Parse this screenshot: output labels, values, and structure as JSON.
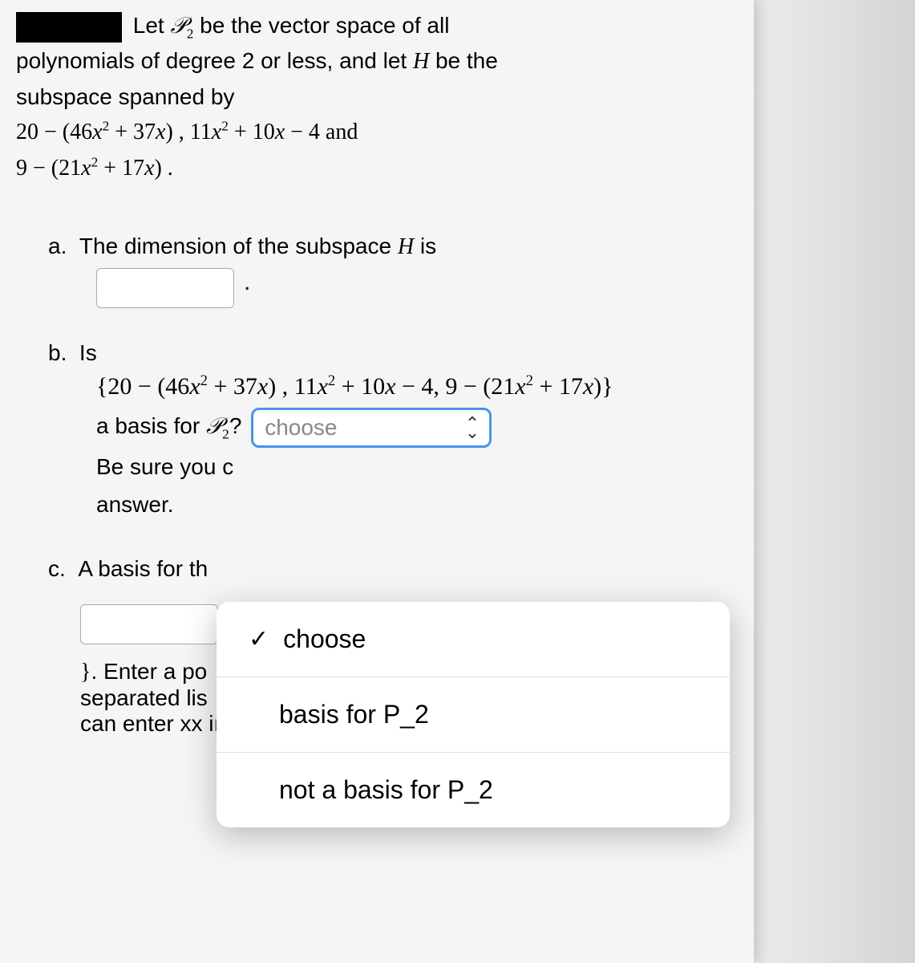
{
  "intro": {
    "line1": " Let ",
    "p2_html": "𝒫",
    "line1b": " be the vector space of all",
    "line2": "polynomials of degree 2 or less, and let ",
    "H": "H",
    "line2b": " be the",
    "line3": "subspace spanned by",
    "poly1a": "20 − (46",
    "poly1b": " + 37",
    "poly1c": ") ,  11",
    "poly1d": " + 10",
    "poly1e": " − 4 and",
    "poly2a": "9 − (21",
    "poly2b": " + 17",
    "poly2c": ") ."
  },
  "parts": {
    "a": {
      "label": "a.",
      "text1": "The dimension of the subspace ",
      "H": "H",
      "text2": " is",
      "period": "."
    },
    "b": {
      "label": "b.",
      "text1": "Is",
      "set_open": "{20 − (46",
      "set_p1": " + 37",
      "set_p2": ") , 11",
      "set_p3": " + 10",
      "set_p4": " − 4, 9 − (21",
      "set_p5": " + 17",
      "set_close": ")}",
      "text3a": "a basis for ",
      "text3b": "? ",
      "select_placeholder": "choose",
      "hint1": "Be sure you c",
      "hint2": "answer."
    },
    "c": {
      "label": "c.",
      "text1": "A basis for th",
      "brace": "}",
      "text2a": ". Enter a po",
      "text2b": "separated lis",
      "text2c": "can enter xx in place of x  )"
    }
  },
  "dropdown": {
    "opt1": "choose",
    "opt2": "basis for P_2",
    "opt3": "not a basis for P_2"
  },
  "math": {
    "x": "x",
    "sq": "2",
    "sub2": "2"
  }
}
